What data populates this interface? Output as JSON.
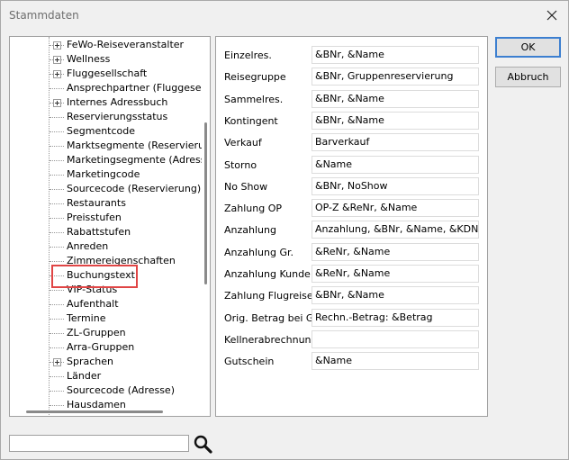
{
  "window": {
    "title": "Stammdaten"
  },
  "tree": {
    "items": [
      {
        "label": "FeWo-Reiseveranstalter",
        "expandable": true
      },
      {
        "label": "Wellness",
        "expandable": true
      },
      {
        "label": "Fluggesellschaft",
        "expandable": true
      },
      {
        "label": "Ansprechpartner (Fluggesellsc",
        "expandable": false
      },
      {
        "label": "Internes Adressbuch",
        "expandable": true
      },
      {
        "label": "Reservierungsstatus",
        "expandable": false
      },
      {
        "label": "Segmentcode",
        "expandable": false
      },
      {
        "label": "Marktsegmente (Reservierun",
        "expandable": false
      },
      {
        "label": "Marketingsegmente (Adresse)",
        "expandable": false
      },
      {
        "label": "Marketingcode",
        "expandable": false
      },
      {
        "label": "Sourcecode (Reservierung)",
        "expandable": false
      },
      {
        "label": "Restaurants",
        "expandable": false
      },
      {
        "label": "Preisstufen",
        "expandable": false
      },
      {
        "label": "Rabattstufen",
        "expandable": false
      },
      {
        "label": "Anreden",
        "expandable": false
      },
      {
        "label": "Zimmereigenschaften",
        "expandable": false
      },
      {
        "label": "Buchungstext",
        "expandable": false,
        "selected": true
      },
      {
        "label": "VIP-Status",
        "expandable": false
      },
      {
        "label": "Aufenthalt",
        "expandable": false
      },
      {
        "label": "Termine",
        "expandable": false
      },
      {
        "label": "ZL-Gruppen",
        "expandable": false
      },
      {
        "label": "Arra-Gruppen",
        "expandable": false
      },
      {
        "label": "Sprachen",
        "expandable": true
      },
      {
        "label": "Länder",
        "expandable": false
      },
      {
        "label": "Sourcecode (Adresse)",
        "expandable": false
      },
      {
        "label": "Hausdamen",
        "expandable": false
      }
    ]
  },
  "search": {
    "value": ""
  },
  "form": {
    "rows": [
      {
        "label": "Einzelres.",
        "value": "&BNr, &Name"
      },
      {
        "label": "Reisegruppe",
        "value": "&BNr, Gruppenreservierung"
      },
      {
        "label": "Sammelres.",
        "value": "&BNr, &Name"
      },
      {
        "label": "Kontingent",
        "value": "&BNr, &Name"
      },
      {
        "label": "Verkauf",
        "value": "Barverkauf"
      },
      {
        "label": "Storno",
        "value": "&Name"
      },
      {
        "label": "No Show",
        "value": "&BNr, NoShow"
      },
      {
        "label": "Zahlung OP",
        "value": "OP-Z &ReNr, &Name"
      },
      {
        "label": "Anzahlung",
        "value": "Anzahlung, &BNr, &Name, &KDNR"
      },
      {
        "label": "Anzahlung Gr.",
        "value": "&ReNr, &Name"
      },
      {
        "label": "Anzahlung Kunde",
        "value": "&ReNr, &Name"
      },
      {
        "label": "Zahlung Flugreise",
        "value": "&BNr, &Name"
      },
      {
        "label": "Orig. Betrag bei GH",
        "value": "Rechn.-Betrag: &Betrag"
      },
      {
        "label": "Kellnerabrechnung",
        "value": ""
      },
      {
        "label": "Gutschein",
        "value": "&Name"
      }
    ]
  },
  "buttons": {
    "ok": "OK",
    "cancel": "Abbruch"
  },
  "colors": {
    "highlight": "#e04545",
    "default_button_border": "#3c7fd0"
  }
}
